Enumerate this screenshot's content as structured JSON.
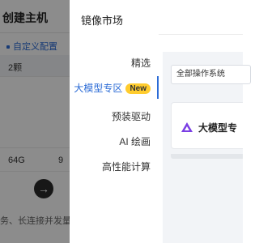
{
  "background": {
    "title": "创建主机",
    "custom_config": "自定义配置",
    "table_head_value": "2颗",
    "row_values": [
      "64G",
      "9"
    ],
    "arrow_icon": "arrow-right-icon",
    "footer_text": "务、长连接并发量大"
  },
  "modal": {
    "title": "镜像市场",
    "nav": [
      {
        "label": "精选",
        "active": false
      },
      {
        "label": "大模型专区",
        "active": true,
        "badge": "New"
      },
      {
        "label": "预装驱动",
        "active": false
      },
      {
        "label": "AI 绘画",
        "active": false
      },
      {
        "label": "高性能计算",
        "active": false
      }
    ],
    "os_select": "全部操作系统",
    "card": {
      "title": "大模型专",
      "icon": "triangle-logo-icon"
    }
  },
  "colors": {
    "accent": "#2b6bd6",
    "badge": "#ffcc2e",
    "logo": "#7b3fe4"
  }
}
